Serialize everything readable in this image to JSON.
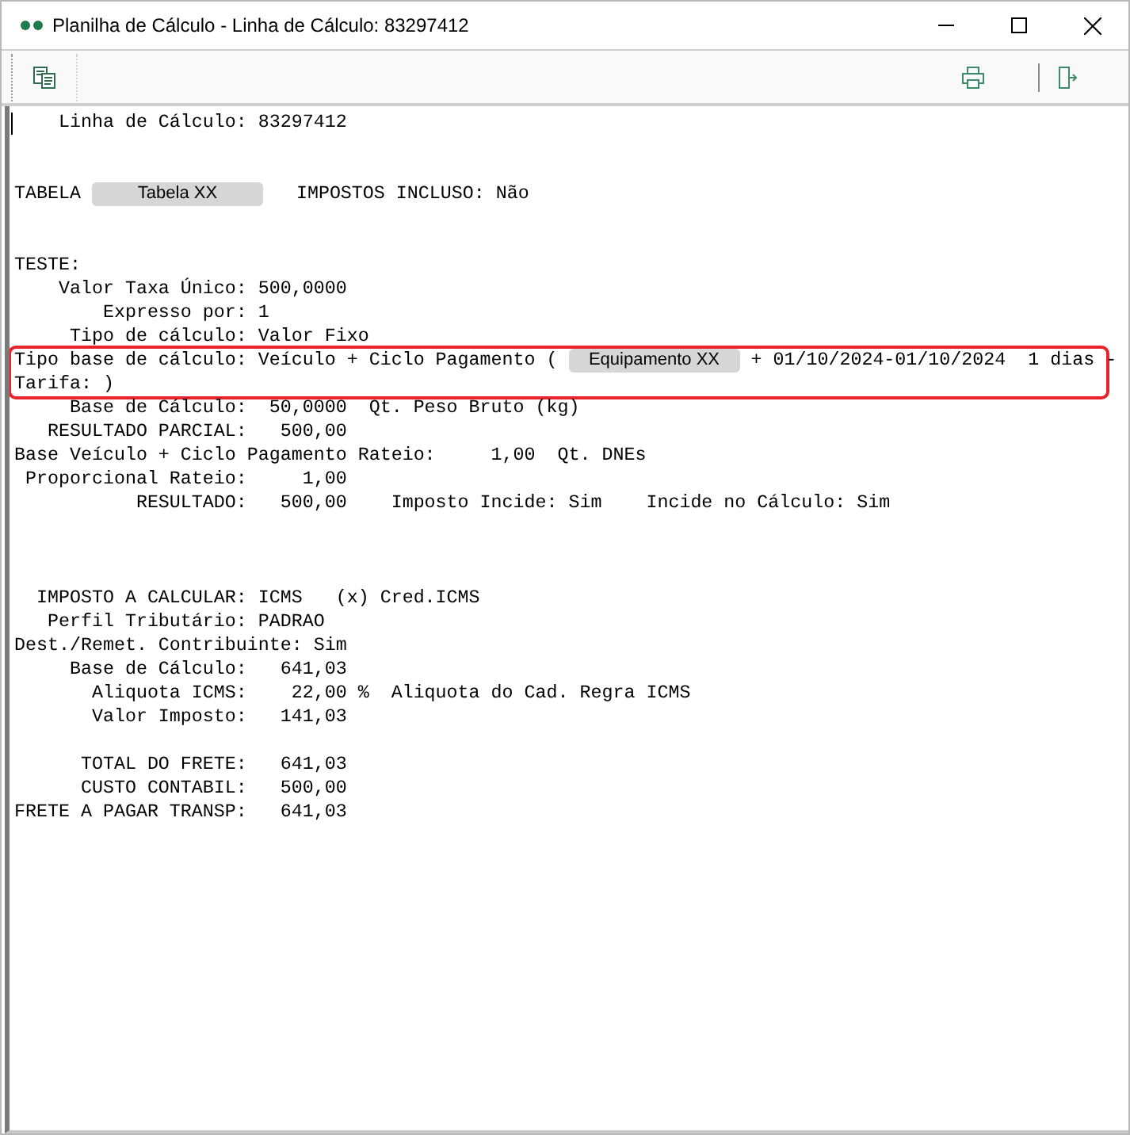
{
  "window": {
    "title": "Planilha de Cálculo - Linha de Cálculo: 83297412"
  },
  "report_lines": [
    {
      "kind": "text",
      "text": "    Linha de Cálculo: 83297412"
    },
    {
      "kind": "blank"
    },
    {
      "kind": "blank"
    },
    {
      "kind": "mixed",
      "segments": [
        {
          "kind": "text",
          "text": "TABELA "
        },
        {
          "kind": "redacted",
          "text": "Tabela XX"
        },
        {
          "kind": "text",
          "text": "   IMPOSTOS INCLUSO: Não"
        }
      ]
    },
    {
      "kind": "blank"
    },
    {
      "kind": "blank"
    },
    {
      "kind": "text",
      "text": "TESTE:"
    },
    {
      "kind": "text",
      "text": "    Valor Taxa Único: 500,0000"
    },
    {
      "kind": "text",
      "text": "        Expresso por: 1"
    },
    {
      "kind": "text",
      "text": "     Tipo de cálculo: Valor Fixo"
    },
    {
      "kind": "highlight",
      "lines": [
        {
          "kind": "mixed",
          "segments": [
            {
              "kind": "text",
              "text": "Tipo base de cálculo: Veículo + Ciclo Pagamento ( "
            },
            {
              "kind": "redacted",
              "text": "Equipamento XX"
            },
            {
              "kind": "text",
              "text": " + 01/10/2024-01/10/2024  1 dias -"
            }
          ]
        },
        {
          "kind": "text",
          "text": "Tarifa: )"
        }
      ]
    },
    {
      "kind": "text",
      "text": "     Base de Cálculo:  50,0000  Qt. Peso Bruto (kg)"
    },
    {
      "kind": "text",
      "text": "   RESULTADO PARCIAL:   500,00"
    },
    {
      "kind": "text",
      "text": "Base Veículo + Ciclo Pagamento Rateio:     1,00  Qt. DNEs"
    },
    {
      "kind": "text",
      "text": " Proporcional Rateio:     1,00"
    },
    {
      "kind": "text",
      "text": "           RESULTADO:   500,00    Imposto Incide: Sim    Incide no Cálculo: Sim"
    },
    {
      "kind": "blank"
    },
    {
      "kind": "blank"
    },
    {
      "kind": "blank"
    },
    {
      "kind": "text",
      "text": "  IMPOSTO A CALCULAR: ICMS   (x) Cred.ICMS"
    },
    {
      "kind": "text",
      "text": "   Perfil Tributário: PADRAO"
    },
    {
      "kind": "text",
      "text": "Dest./Remet. Contribuinte: Sim"
    },
    {
      "kind": "text",
      "text": "     Base de Cálculo:   641,03"
    },
    {
      "kind": "text",
      "text": "       Aliquota ICMS:    22,00 %  Aliquota do Cad. Regra ICMS"
    },
    {
      "kind": "text",
      "text": "       Valor Imposto:   141,03"
    },
    {
      "kind": "blank"
    },
    {
      "kind": "text",
      "text": "      TOTAL DO FRETE:   641,03"
    },
    {
      "kind": "text",
      "text": "      CUSTO CONTABIL:   500,00"
    },
    {
      "kind": "text",
      "text": "FRETE A PAGAR TRANSP:   641,03"
    }
  ]
}
